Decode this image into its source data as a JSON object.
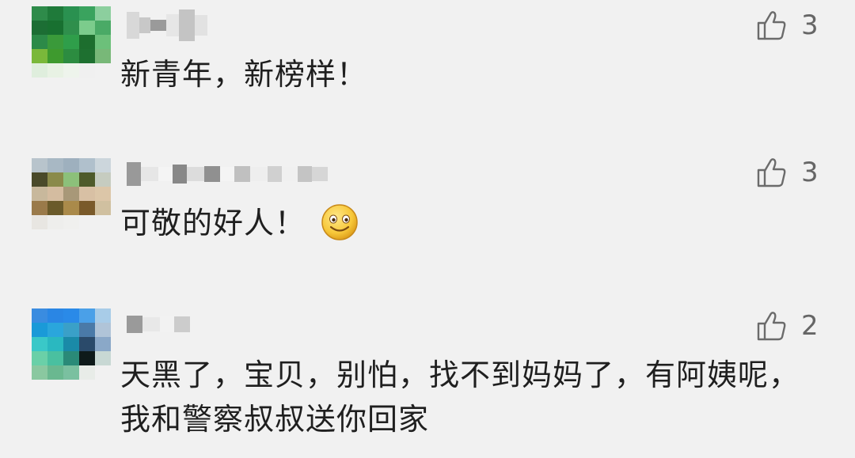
{
  "comments": [
    {
      "text": "新青年，新榜样！",
      "likes": "3",
      "has_emoji": false,
      "avatar_colors": [
        "#2e8b4a",
        "#1f7a3a",
        "#2a9150",
        "#3aa35e",
        "#8ccf9e",
        "#1c6e34",
        "#187030",
        "#2f8f4c",
        "#7ccc8c",
        "#4aaa66",
        "#2c8a48",
        "#3a9a3a",
        "#2f9e4a",
        "#1d6e2e",
        "#6cc07a",
        "#7ab83a",
        "#3e9a2e",
        "#2c8c40",
        "#1e7030",
        "#78b878",
        "#dfeedd",
        "#e8f2e4",
        "#eef4ec",
        "#f0f0f0",
        "#f1f1f1"
      ],
      "username_blocks": [
        {
          "w": 16,
          "h": 34,
          "c": "#d8d8d8"
        },
        {
          "w": 14,
          "h": 20,
          "c": "#c8c8c8"
        },
        {
          "w": 20,
          "h": 14,
          "c": "#9a9a9a"
        },
        {
          "w": 16,
          "h": 28,
          "c": "#e6e6e6"
        },
        {
          "w": 20,
          "h": 40,
          "c": "#c4c4c4"
        },
        {
          "w": 16,
          "h": 26,
          "c": "#e2e2e2"
        }
      ]
    },
    {
      "text": "可敬的好人！",
      "likes": "3",
      "has_emoji": true,
      "emoji_name": "smile-emoji",
      "avatar_colors": [
        "#b8c4cc",
        "#a8b8c4",
        "#9eb0be",
        "#b0c0cc",
        "#ccd6dc",
        "#4a4a2a",
        "#8a8a4a",
        "#8cc07a",
        "#4e5a2a",
        "#c6ccc0",
        "#c8b89c",
        "#d4bca0",
        "#a89878",
        "#d8c0a4",
        "#dcc6a8",
        "#9a7a4a",
        "#6a5a2a",
        "#aa8a4a",
        "#7a5a2a",
        "#d0c0a0",
        "#e8e6e2",
        "#eeeeec",
        "#f0f0ee",
        "#f1f1f1",
        "#f1f1f1"
      ],
      "username_blocks": [
        {
          "w": 18,
          "h": 30,
          "c": "#999999"
        },
        {
          "w": 22,
          "h": 18,
          "c": "#e6e6e6"
        },
        {
          "w": 18,
          "h": 18,
          "c": "#f4f4f4"
        },
        {
          "w": 18,
          "h": 24,
          "c": "#888888"
        },
        {
          "w": 22,
          "h": 18,
          "c": "#dcdcdc"
        },
        {
          "w": 20,
          "h": 20,
          "c": "#909090"
        },
        {
          "w": 18,
          "h": 18,
          "c": "#f4f4f4"
        },
        {
          "w": 20,
          "h": 20,
          "c": "#c0c0c0"
        },
        {
          "w": 22,
          "h": 18,
          "c": "#eeeeee"
        },
        {
          "w": 18,
          "h": 20,
          "c": "#d0d0d0"
        },
        {
          "w": 20,
          "h": 18,
          "c": "#f0f0f0"
        },
        {
          "w": 18,
          "h": 20,
          "c": "#c4c4c4"
        },
        {
          "w": 20,
          "h": 18,
          "c": "#d6d6d6"
        }
      ]
    },
    {
      "text": "天黑了，宝贝，别怕，找不到妈妈了，有阿姨呢，我和警察叔叔送你回家",
      "likes": "2",
      "has_emoji": false,
      "avatar_colors": [
        "#3a8ce0",
        "#2a86e4",
        "#2a8ae8",
        "#4aa0e8",
        "#a8cce8",
        "#1a9ad8",
        "#2aa6dc",
        "#3aa0c8",
        "#4a7aa8",
        "#b0c4d8",
        "#3ac8c8",
        "#2ab8c0",
        "#1a8aa8",
        "#2a4a6a",
        "#8aa8c8",
        "#6ad0a8",
        "#4ac0a0",
        "#2a8a78",
        "#0e1a1a",
        "#c8d8d4",
        "#8ac8a0",
        "#6ab890",
        "#7ac0a0",
        "#e8ece8",
        "#f1f1f1"
      ],
      "username_blocks": [
        {
          "w": 20,
          "h": 22,
          "c": "#9a9a9a"
        },
        {
          "w": 22,
          "h": 18,
          "c": "#e8e8e8"
        },
        {
          "w": 18,
          "h": 20,
          "c": "#f2f2f2"
        },
        {
          "w": 20,
          "h": 20,
          "c": "#cccccc"
        }
      ]
    }
  ]
}
